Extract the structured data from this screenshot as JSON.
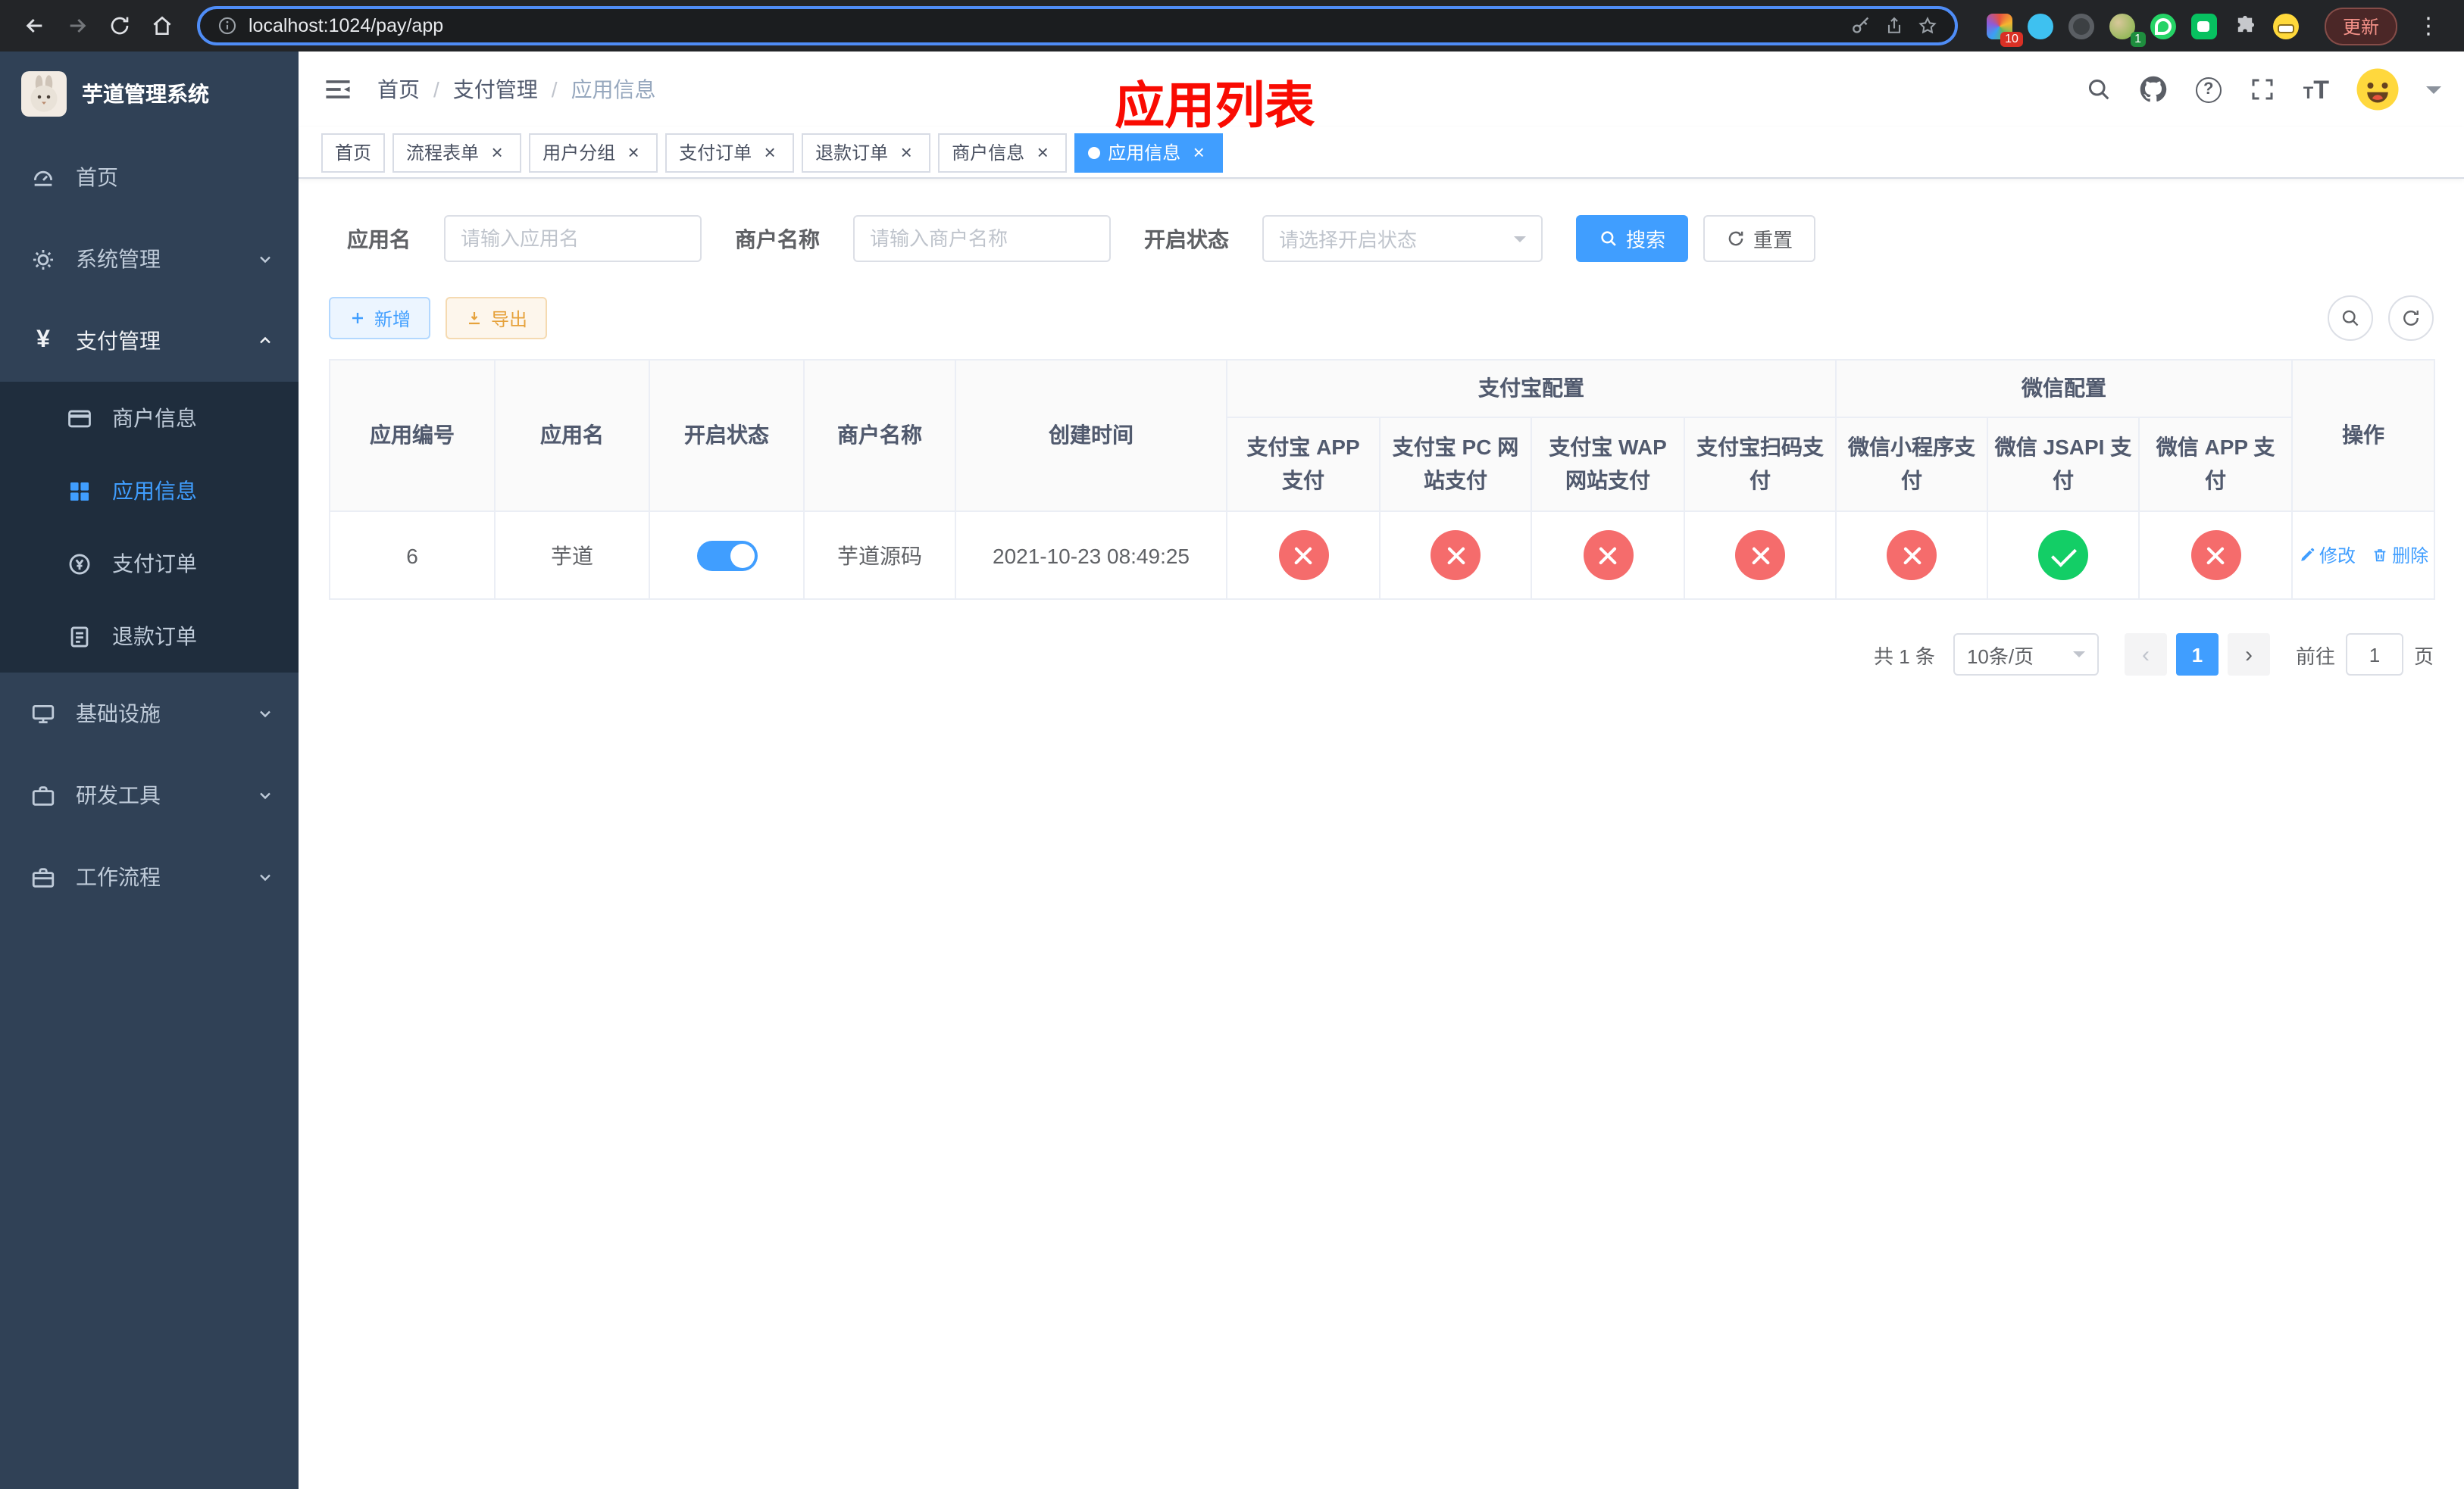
{
  "browser": {
    "url": "localhost:1024/pay/app",
    "update_label": "更新",
    "ext_badge_first": "10",
    "ext_badge_second": "1"
  },
  "sidebar": {
    "title": "芋道管理系统",
    "menu": [
      {
        "label": "首页"
      },
      {
        "label": "系统管理"
      },
      {
        "label": "支付管理"
      },
      {
        "label": "商户信息"
      },
      {
        "label": "应用信息"
      },
      {
        "label": "支付订单"
      },
      {
        "label": "退款订单"
      },
      {
        "label": "基础设施"
      },
      {
        "label": "研发工具"
      },
      {
        "label": "工作流程"
      }
    ]
  },
  "navbar": {
    "breadcrumb": [
      "首页",
      "支付管理",
      "应用信息"
    ],
    "annotation": "应用列表"
  },
  "tabs": [
    {
      "label": "首页"
    },
    {
      "label": "流程表单"
    },
    {
      "label": "用户分组"
    },
    {
      "label": "支付订单"
    },
    {
      "label": "退款订单"
    },
    {
      "label": "商户信息"
    },
    {
      "label": "应用信息"
    }
  ],
  "filters": {
    "app_name_label": "应用名",
    "app_name_placeholder": "请输入应用名",
    "merchant_label": "商户名称",
    "merchant_placeholder": "请输入商户名称",
    "status_label": "开启状态",
    "status_placeholder": "请选择开启状态",
    "search_label": "搜索",
    "reset_label": "重置"
  },
  "toolbar": {
    "add_label": "新增",
    "export_label": "导出"
  },
  "table": {
    "group_alipay": "支付宝配置",
    "group_wechat": "微信配置",
    "columns": {
      "id": "应用编号",
      "name": "应用名",
      "status": "开启状态",
      "merchant": "商户名称",
      "created": "创建时间",
      "alipay_app": "支付宝 APP 支付",
      "alipay_pc": "支付宝 PC 网站支付",
      "alipay_wap": "支付宝 WAP 网站支付",
      "alipay_qr": "支付宝扫码支付",
      "wx_mini": "微信小程序支付",
      "wx_jsapi": "微信 JSAPI 支付",
      "wx_app": "微信 APP 支付",
      "actions": "操作"
    },
    "row": {
      "id": "6",
      "name": "芋道",
      "status_on": true,
      "merchant": "芋道源码",
      "created": "2021-10-23 08:49:25",
      "configs": [
        "no",
        "no",
        "no",
        "no",
        "no",
        "yes",
        "no"
      ],
      "edit_label": "修改",
      "delete_label": "删除"
    }
  },
  "pagination": {
    "total": "共 1 条",
    "page_size": "10条/页",
    "current": "1",
    "goto_prefix": "前往",
    "goto_value": "1",
    "goto_suffix": "页"
  },
  "icons": {
    "status_enabled": "green-check-circle",
    "status_disabled": "red-x-circle",
    "search": "magnifier",
    "reset": "refresh-arrows",
    "add": "plus",
    "export": "download-arrow"
  },
  "colors": {
    "primary": "#409EFF",
    "danger": "#F56C6C",
    "success": "#13CE66",
    "warning": "#E6A23C",
    "sidebar_bg": "#304156",
    "submenu_bg": "#1F2D3D",
    "annotation_red": "#F90B02"
  }
}
